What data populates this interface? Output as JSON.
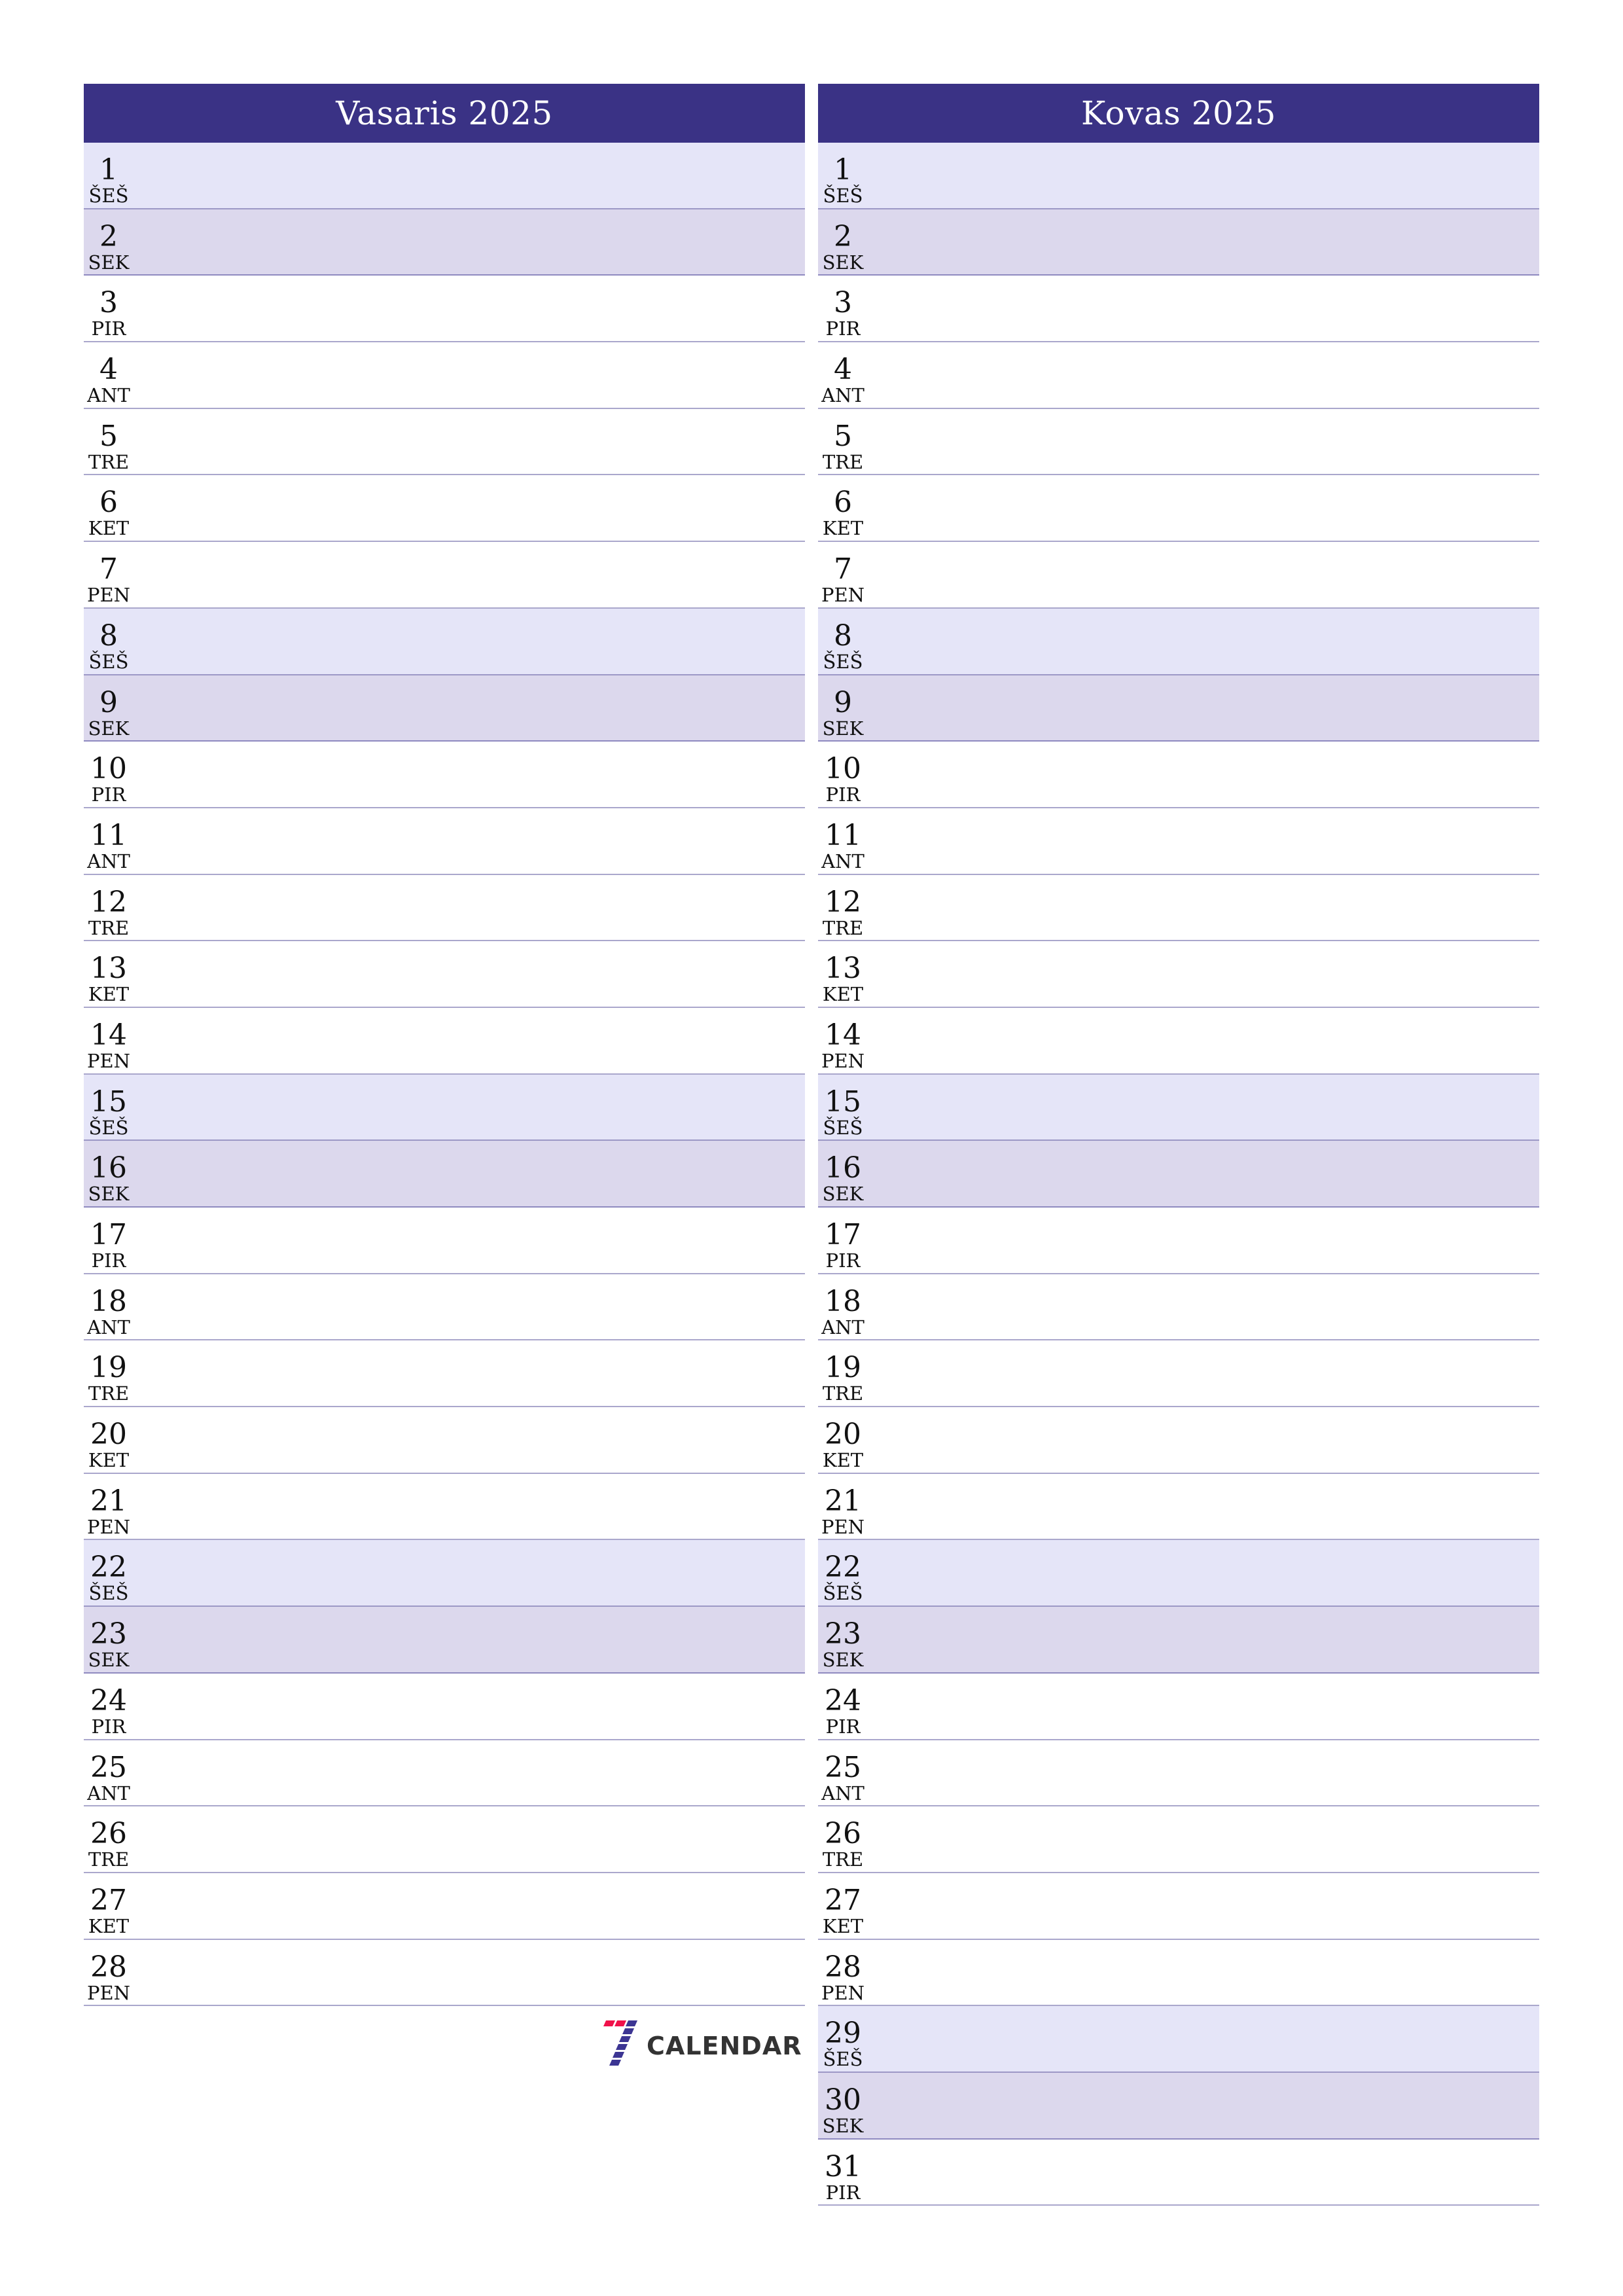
{
  "months": [
    {
      "title": "Vasaris 2025",
      "days": [
        {
          "num": "1",
          "name": "ŠEŠ",
          "type": "sat"
        },
        {
          "num": "2",
          "name": "SEK",
          "type": "sun"
        },
        {
          "num": "3",
          "name": "PIR",
          "type": "wd"
        },
        {
          "num": "4",
          "name": "ANT",
          "type": "wd"
        },
        {
          "num": "5",
          "name": "TRE",
          "type": "wd"
        },
        {
          "num": "6",
          "name": "KET",
          "type": "wd"
        },
        {
          "num": "7",
          "name": "PEN",
          "type": "wd"
        },
        {
          "num": "8",
          "name": "ŠEŠ",
          "type": "sat"
        },
        {
          "num": "9",
          "name": "SEK",
          "type": "sun"
        },
        {
          "num": "10",
          "name": "PIR",
          "type": "wd"
        },
        {
          "num": "11",
          "name": "ANT",
          "type": "wd"
        },
        {
          "num": "12",
          "name": "TRE",
          "type": "wd"
        },
        {
          "num": "13",
          "name": "KET",
          "type": "wd"
        },
        {
          "num": "14",
          "name": "PEN",
          "type": "wd"
        },
        {
          "num": "15",
          "name": "ŠEŠ",
          "type": "sat"
        },
        {
          "num": "16",
          "name": "SEK",
          "type": "sun"
        },
        {
          "num": "17",
          "name": "PIR",
          "type": "wd"
        },
        {
          "num": "18",
          "name": "ANT",
          "type": "wd"
        },
        {
          "num": "19",
          "name": "TRE",
          "type": "wd"
        },
        {
          "num": "20",
          "name": "KET",
          "type": "wd"
        },
        {
          "num": "21",
          "name": "PEN",
          "type": "wd"
        },
        {
          "num": "22",
          "name": "ŠEŠ",
          "type": "sat"
        },
        {
          "num": "23",
          "name": "SEK",
          "type": "sun"
        },
        {
          "num": "24",
          "name": "PIR",
          "type": "wd"
        },
        {
          "num": "25",
          "name": "ANT",
          "type": "wd"
        },
        {
          "num": "26",
          "name": "TRE",
          "type": "wd"
        },
        {
          "num": "27",
          "name": "KET",
          "type": "wd"
        },
        {
          "num": "28",
          "name": "PEN",
          "type": "wd"
        }
      ]
    },
    {
      "title": "Kovas 2025",
      "days": [
        {
          "num": "1",
          "name": "ŠEŠ",
          "type": "sat"
        },
        {
          "num": "2",
          "name": "SEK",
          "type": "sun"
        },
        {
          "num": "3",
          "name": "PIR",
          "type": "wd"
        },
        {
          "num": "4",
          "name": "ANT",
          "type": "wd"
        },
        {
          "num": "5",
          "name": "TRE",
          "type": "wd"
        },
        {
          "num": "6",
          "name": "KET",
          "type": "wd"
        },
        {
          "num": "7",
          "name": "PEN",
          "type": "wd"
        },
        {
          "num": "8",
          "name": "ŠEŠ",
          "type": "sat"
        },
        {
          "num": "9",
          "name": "SEK",
          "type": "sun"
        },
        {
          "num": "10",
          "name": "PIR",
          "type": "wd"
        },
        {
          "num": "11",
          "name": "ANT",
          "type": "wd"
        },
        {
          "num": "12",
          "name": "TRE",
          "type": "wd"
        },
        {
          "num": "13",
          "name": "KET",
          "type": "wd"
        },
        {
          "num": "14",
          "name": "PEN",
          "type": "wd"
        },
        {
          "num": "15",
          "name": "ŠEŠ",
          "type": "sat"
        },
        {
          "num": "16",
          "name": "SEK",
          "type": "sun"
        },
        {
          "num": "17",
          "name": "PIR",
          "type": "wd"
        },
        {
          "num": "18",
          "name": "ANT",
          "type": "wd"
        },
        {
          "num": "19",
          "name": "TRE",
          "type": "wd"
        },
        {
          "num": "20",
          "name": "KET",
          "type": "wd"
        },
        {
          "num": "21",
          "name": "PEN",
          "type": "wd"
        },
        {
          "num": "22",
          "name": "ŠEŠ",
          "type": "sat"
        },
        {
          "num": "23",
          "name": "SEK",
          "type": "sun"
        },
        {
          "num": "24",
          "name": "PIR",
          "type": "wd"
        },
        {
          "num": "25",
          "name": "ANT",
          "type": "wd"
        },
        {
          "num": "26",
          "name": "TRE",
          "type": "wd"
        },
        {
          "num": "27",
          "name": "KET",
          "type": "wd"
        },
        {
          "num": "28",
          "name": "PEN",
          "type": "wd"
        },
        {
          "num": "29",
          "name": "ŠEŠ",
          "type": "sat"
        },
        {
          "num": "30",
          "name": "SEK",
          "type": "sun"
        },
        {
          "num": "31",
          "name": "PIR",
          "type": "wd"
        }
      ]
    }
  ],
  "logo": {
    "text": "CALENDAR",
    "icon": "seven-calendar-logo-icon",
    "colors": {
      "accent_red": "#f0114a",
      "accent_purple": "#3c3593",
      "text": "#333333"
    }
  },
  "colors": {
    "header": "#3a3285",
    "saturday": "#e5e5f8",
    "sunday": "#dcd8ed",
    "row_border": "#aaa7cc"
  }
}
